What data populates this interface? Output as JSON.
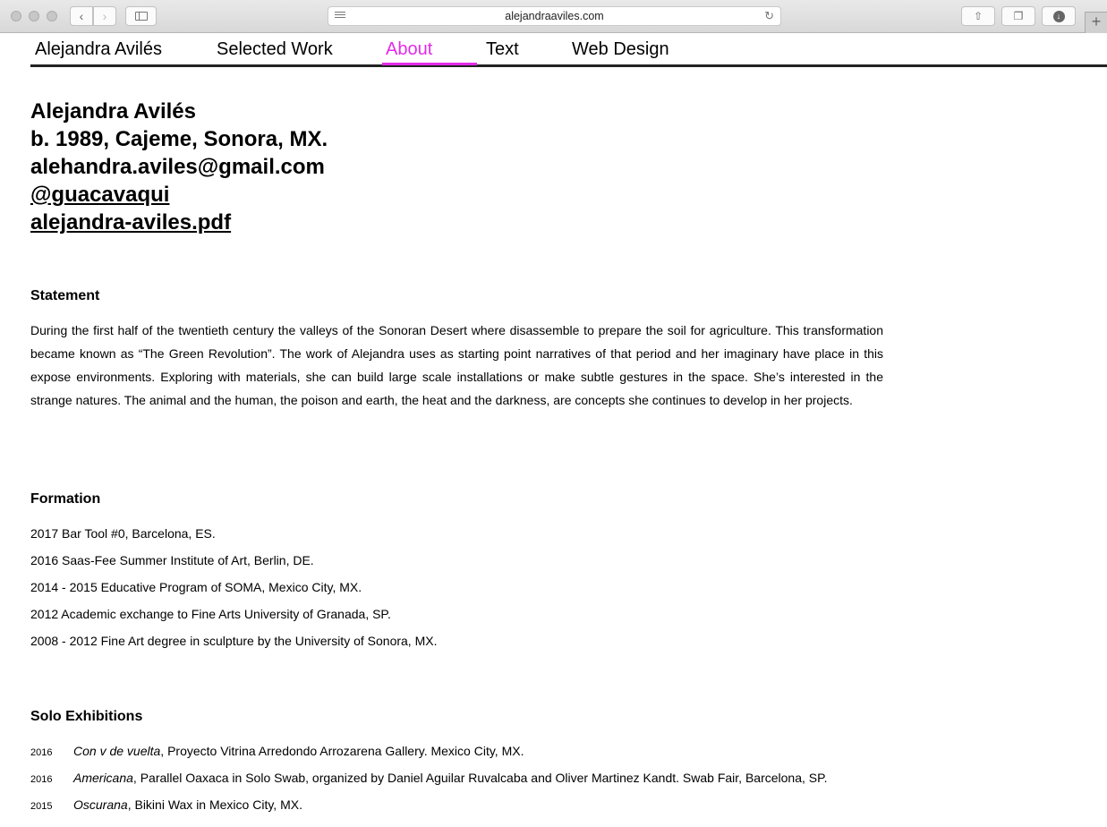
{
  "browser": {
    "url": "alejandraaviles.com"
  },
  "nav": {
    "items": [
      {
        "label": "Alejandra Avilés"
      },
      {
        "label": "Selected Work"
      },
      {
        "label": "About"
      },
      {
        "label": "Text"
      },
      {
        "label": "Web Design"
      }
    ],
    "active": "About",
    "active_color": "#e22ae8"
  },
  "profile": {
    "name": "Alejandra Avilés",
    "birth": "b. 1989, Cajeme, Sonora, MX.",
    "email": "alehandra.aviles@gmail.com",
    "handle": "@guacavaqui",
    "cv_link": "alejandra-aviles.pdf"
  },
  "statement": {
    "heading": "Statement",
    "text": "During the first half of the twentieth century the valleys of the Sonoran Desert where disassemble to prepare the soil for agriculture. This transformation became known as “The Green Revolution”. The work of Alejandra uses as starting point narratives of that period and her imaginary have place in this expose environments. Exploring with materials, she can build large scale installations or make subtle gestures in the space. She’s interested in the strange natures. The animal and the human, the poison and earth, the heat and the darkness, are concepts she continues to develop in her projects."
  },
  "formation": {
    "heading": "Formation",
    "items": [
      "2017 Bar Tool #0, Barcelona, ES.",
      "2016 Saas-Fee Summer Institute of Art, Berlin, DE.",
      "2014 - 2015 Educative Program of SOMA, Mexico City, MX.",
      "2012 Academic exchange to Fine Arts University of Granada, SP.",
      "2008 - 2012 Fine Art degree in sculpture by the University of Sonora, MX."
    ]
  },
  "solo": {
    "heading": "Solo Exhibitions",
    "items": [
      {
        "year": "2016",
        "title": "Con v de vuelta",
        "rest": ", Proyecto Vitrina Arredondo Arrozarena Gallery. Mexico City, MX."
      },
      {
        "year": "2016",
        "title": "Americana",
        "rest": ", Parallel Oaxaca in Solo Swab, organized by Daniel Aguilar Ruvalcaba and Oliver Martinez Kandt. Swab Fair, Barcelona, SP."
      },
      {
        "year": "2015",
        "title": "Oscurana",
        "rest": ", Bikini Wax in Mexico City, MX."
      }
    ]
  }
}
